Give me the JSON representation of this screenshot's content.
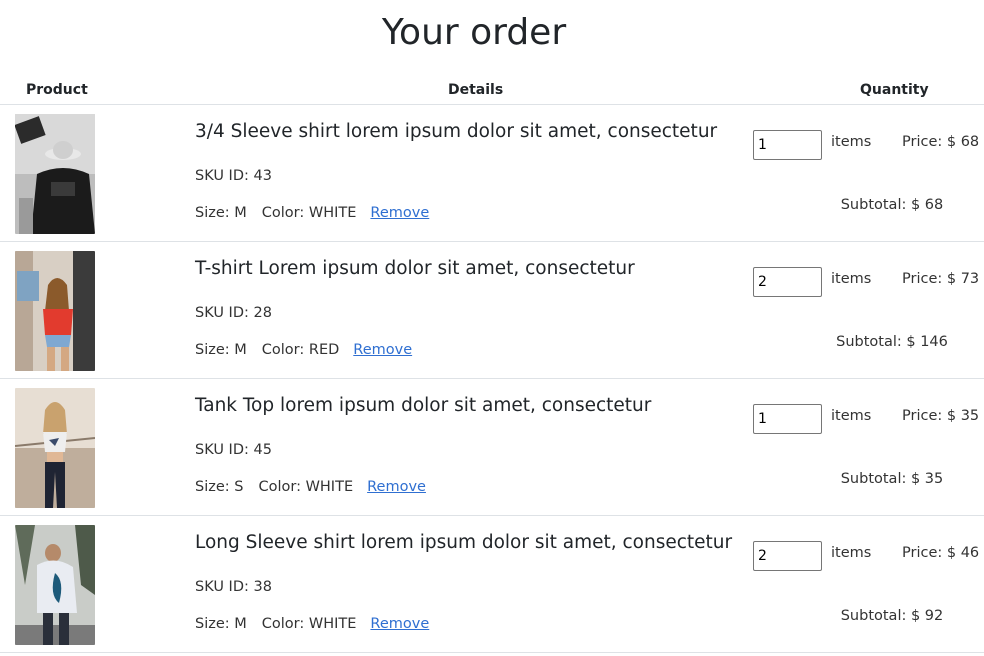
{
  "page": {
    "title": "Your order"
  },
  "table": {
    "headers": {
      "product": "Product",
      "details": "Details",
      "quantity": "Quantity"
    },
    "rows": [
      {
        "title": "3/4 Sleeve shirt lorem ipsum dolor sit amet, consectetur",
        "sku": "SKU ID: 43",
        "size": "Size: M",
        "color": "Color: WHITE",
        "remove": "Remove",
        "quantity": "1",
        "items_label": "items",
        "price": "Price: $ 68",
        "subtotal": "Subtotal: $ 68"
      },
      {
        "title": "T-shirt Lorem ipsum dolor sit amet, consectetur",
        "sku": "SKU ID: 28",
        "size": "Size: M",
        "color": "Color: RED",
        "remove": "Remove",
        "quantity": "2",
        "items_label": "items",
        "price": "Price: $ 73",
        "subtotal": "Subtotal: $ 146"
      },
      {
        "title": "Tank Top lorem ipsum dolor sit amet, consectetur",
        "sku": "SKU ID: 45",
        "size": "Size: S",
        "color": "Color: WHITE",
        "remove": "Remove",
        "quantity": "1",
        "items_label": "items",
        "price": "Price: $ 35",
        "subtotal": "Subtotal: $ 35"
      },
      {
        "title": "Long Sleeve shirt lorem ipsum dolor sit amet, consectetur",
        "sku": "SKU ID: 38",
        "size": "Size: M",
        "color": "Color: WHITE",
        "remove": "Remove",
        "quantity": "2",
        "items_label": "items",
        "price": "Price: $ 46",
        "subtotal": "Subtotal: $ 92"
      }
    ]
  },
  "colors": {
    "link": "#2f6fd1",
    "border": "#dee2e6",
    "text": "#212529"
  }
}
